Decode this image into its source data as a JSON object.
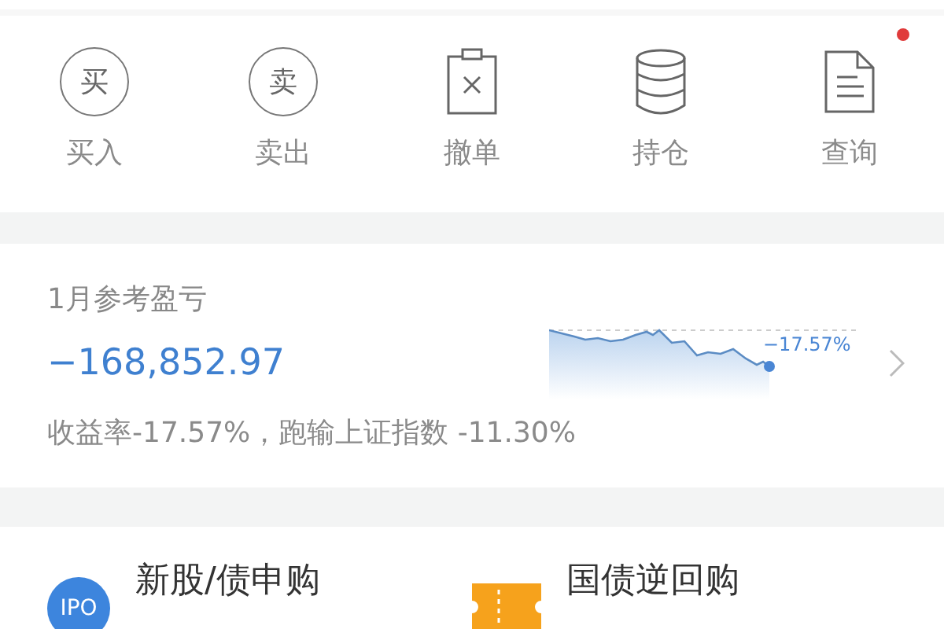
{
  "actions": [
    {
      "kind": "buy",
      "glyph": "买",
      "label": "买入",
      "badge": false
    },
    {
      "kind": "sell",
      "glyph": "卖",
      "label": "卖出",
      "badge": false
    },
    {
      "kind": "cancel",
      "label": "撤单",
      "badge": false
    },
    {
      "kind": "position",
      "label": "持仓",
      "badge": false
    },
    {
      "kind": "query",
      "label": "查询",
      "badge": true
    }
  ],
  "pnl": {
    "title": "1月参考盈亏",
    "amount": "−168,852.97",
    "sparkline_label": "−17.57%",
    "summary": "收益率-17.57%，跑输上证指数 -11.30%"
  },
  "services": [
    {
      "kind": "ipo",
      "glyph": "IPO",
      "title": "新股/债申购"
    },
    {
      "kind": "repo",
      "title": "国债逆回购"
    }
  ]
}
